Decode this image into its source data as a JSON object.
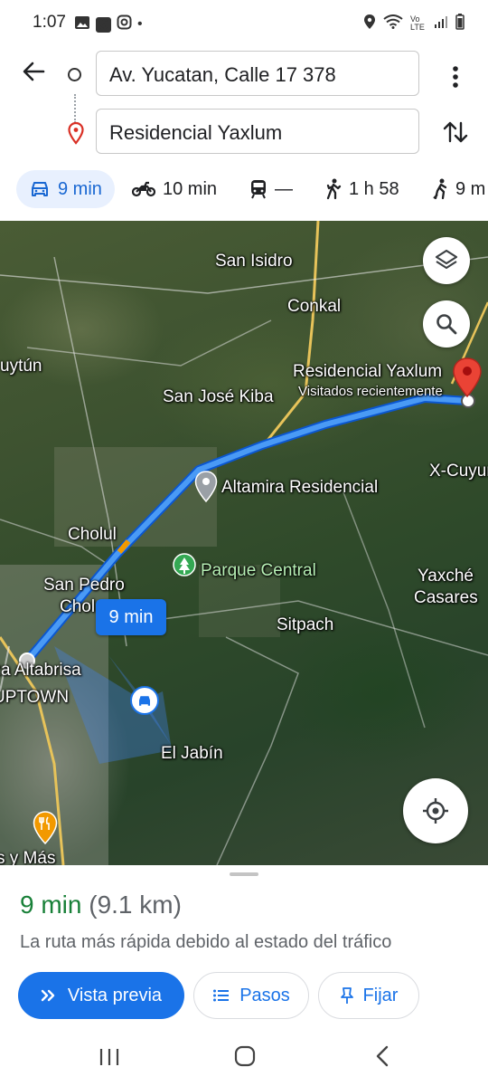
{
  "status_bar": {
    "time": "1:07",
    "notif_dot": "•",
    "icons": [
      "image-icon",
      "s-app-icon",
      "instagram-icon",
      "location-icon",
      "wifi-icon",
      "volte-icon",
      "signal-icon",
      "battery-icon"
    ],
    "volte": "Vo LTE"
  },
  "directions": {
    "origin": "Av. Yucatan, Calle 17 378",
    "destination": "Residencial Yaxlum"
  },
  "modes": [
    {
      "icon": "car-icon",
      "label": "9 min",
      "active": true
    },
    {
      "icon": "motorcycle-icon",
      "label": "10 min",
      "active": false
    },
    {
      "icon": "transit-icon",
      "label": "—",
      "active": false
    },
    {
      "icon": "walk-icon",
      "label": "1 h 58",
      "active": false
    },
    {
      "icon": "ride-icon",
      "label": "9 m",
      "active": false
    }
  ],
  "map": {
    "labels": {
      "san_isidro": "San Isidro",
      "conkal": "Conkal",
      "uytun": "uytún",
      "residencial_yaxlum": "Residencial Yaxlum",
      "visitados": "Visitados recientemente",
      "san_jose_kiba": "San José Kiba",
      "x_cuyum": "X-Cuyum",
      "altamira": "Altamira Residencial",
      "cholul": "Cholul",
      "parque_central": "Parque Central",
      "yaxche": "Yaxché",
      "casares": "Casares",
      "san_pedro": "San Pedro",
      "cholul2": "Chol",
      "sitpach": "Sitpach",
      "altabrisa": "Plaza Altabrisa",
      "uptown": "UPTOWN",
      "el_jabin": "El Jabín",
      "mas": "s y Más"
    },
    "route_time": "9 min",
    "colors": {
      "route": "#1a73e8",
      "route_outline": "#0b57d0",
      "pin": "#ea4335"
    }
  },
  "sheet": {
    "time": "9 min",
    "distance": "(9.1 km)",
    "description": "La ruta más rápida debido al estado del tráfico",
    "buttons": {
      "preview": "Vista previa",
      "steps": "Pasos",
      "pin": "Fijar"
    }
  },
  "accent": "#1a73e8",
  "green": "#188038"
}
